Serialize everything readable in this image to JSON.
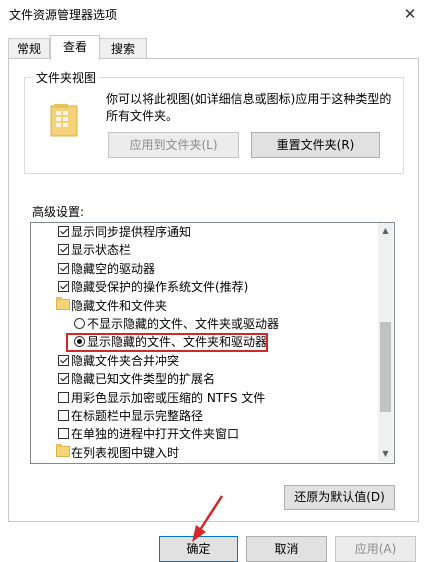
{
  "window": {
    "title": "文件资源管理器选项",
    "close_glyph": "✕"
  },
  "tabs": [
    {
      "label": "常规",
      "active": false
    },
    {
      "label": "查看",
      "active": true
    },
    {
      "label": "搜索",
      "active": false
    }
  ],
  "folder_view": {
    "caption": "文件夹视图",
    "description": "你可以将此视图(如详细信息或图标)应用于这种类型的所有文件夹。",
    "apply_button": "应用到文件夹(L)",
    "reset_button": "重置文件夹(R)"
  },
  "advanced": {
    "label": "高级设置:",
    "items": [
      {
        "type": "checkbox",
        "checked": true,
        "indent": 0,
        "label": "显示同步提供程序通知"
      },
      {
        "type": "checkbox",
        "checked": true,
        "indent": 0,
        "label": "显示状态栏"
      },
      {
        "type": "checkbox",
        "checked": true,
        "indent": 0,
        "label": "隐藏空的驱动器"
      },
      {
        "type": "checkbox",
        "checked": true,
        "indent": 0,
        "label": "隐藏受保护的操作系统文件(推荐)"
      },
      {
        "type": "folder",
        "indent": 0,
        "label": "隐藏文件和文件夹"
      },
      {
        "type": "radio",
        "checked": false,
        "indent": 1,
        "label": "不显示隐藏的文件、文件夹或驱动器"
      },
      {
        "type": "radio",
        "checked": true,
        "indent": 1,
        "label": "显示隐藏的文件、文件夹和驱动器"
      },
      {
        "type": "checkbox",
        "checked": true,
        "indent": 0,
        "label": "隐藏文件夹合并冲突"
      },
      {
        "type": "checkbox",
        "checked": true,
        "indent": 0,
        "label": "隐藏已知文件类型的扩展名"
      },
      {
        "type": "checkbox",
        "checked": false,
        "indent": 0,
        "label": "用彩色显示加密或压缩的 NTFS 文件"
      },
      {
        "type": "checkbox",
        "checked": false,
        "indent": 0,
        "label": "在标题栏中显示完整路径"
      },
      {
        "type": "checkbox",
        "checked": false,
        "indent": 0,
        "label": "在单独的进程中打开文件夹窗口"
      },
      {
        "type": "folder",
        "indent": 0,
        "label": "在列表视图中键入时"
      }
    ],
    "restore_button": "还原为默认值(D)"
  },
  "footer": {
    "ok_button": "确定",
    "cancel_button": "取消",
    "apply_button": "应用(A)"
  },
  "colors": {
    "highlight": "#d42727",
    "arrow": "#d42727"
  }
}
